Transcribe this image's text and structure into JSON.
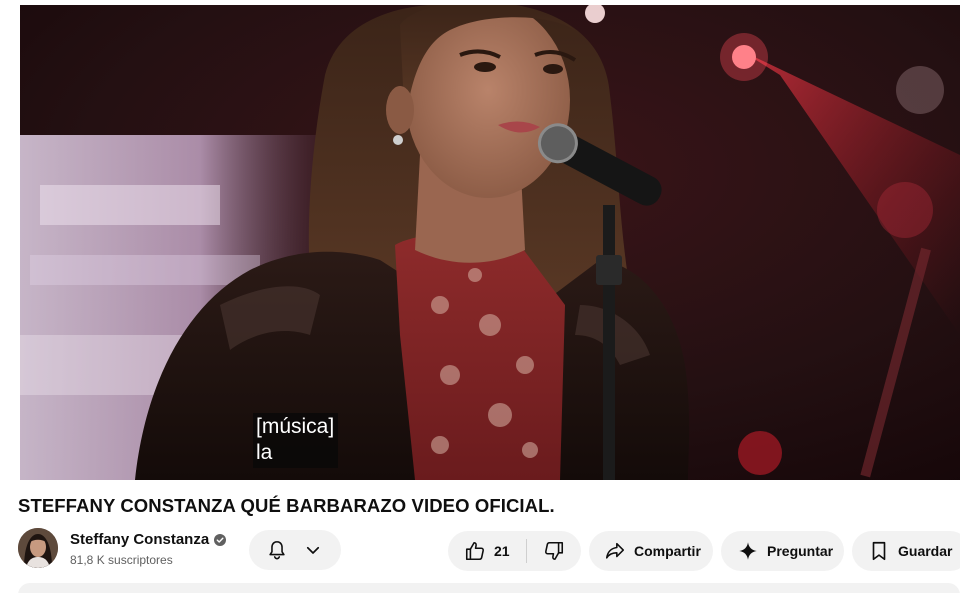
{
  "player": {
    "captions": [
      "[música]",
      "la"
    ]
  },
  "video": {
    "title": "STEFFANY CONSTANZA QUÉ BARBARAZO VIDEO OFICIAL."
  },
  "owner": {
    "channel_name": "Steffany Constanza",
    "subscribers": "81,8 K suscriptores",
    "verified_icon": "verified-badge-icon"
  },
  "actions": {
    "like_count": "21",
    "share_label": "Compartir",
    "ask_label": "Preguntar",
    "save_label": "Guardar",
    "icons": [
      "bell-icon",
      "chevron-down-icon",
      "thumbs-up-icon",
      "thumbs-down-icon",
      "share-icon",
      "sparkle-icon",
      "bookmark-icon"
    ]
  },
  "colors": {
    "pill_background": "#f2f2f2",
    "secondary_text": "#606060",
    "stage_red": "#c0182a"
  }
}
